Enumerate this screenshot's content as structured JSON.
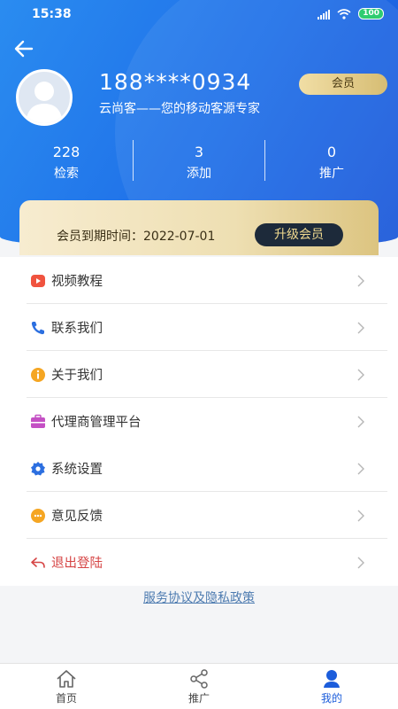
{
  "status": {
    "time": "15:38",
    "battery": "100"
  },
  "profile": {
    "phone": "188****0934",
    "slogan": "云尚客——您的移动客源专家",
    "member_badge": "会员"
  },
  "stats": [
    {
      "value": "228",
      "label": "检索"
    },
    {
      "value": "3",
      "label": "添加"
    },
    {
      "value": "0",
      "label": "推广"
    }
  ],
  "vip": {
    "expire_text": "会员到期时间：2022-07-01",
    "upgrade_label": "升级会员"
  },
  "menu": {
    "group1": [
      {
        "label": "视频教程",
        "icon": "video-icon"
      }
    ],
    "group2": [
      {
        "label": "联系我们",
        "icon": "phone-icon"
      },
      {
        "label": "关于我们",
        "icon": "info-icon"
      },
      {
        "label": "代理商管理平台",
        "icon": "agent-icon"
      }
    ],
    "group3": [
      {
        "label": "系统设置",
        "icon": "settings-icon"
      },
      {
        "label": "意见反馈",
        "icon": "feedback-icon"
      },
      {
        "label": "退出登陆",
        "icon": "logout-icon"
      }
    ]
  },
  "policy_link": "服务协议及隐私政策",
  "tabs": [
    {
      "label": "首页",
      "icon": "home-icon"
    },
    {
      "label": "推广",
      "icon": "share-icon"
    },
    {
      "label": "我的",
      "icon": "user-icon"
    }
  ],
  "colors": {
    "primary": "#1f6fe8",
    "gold": "#d6bd74",
    "logout": "#d64545",
    "link": "#4d7bb0"
  }
}
